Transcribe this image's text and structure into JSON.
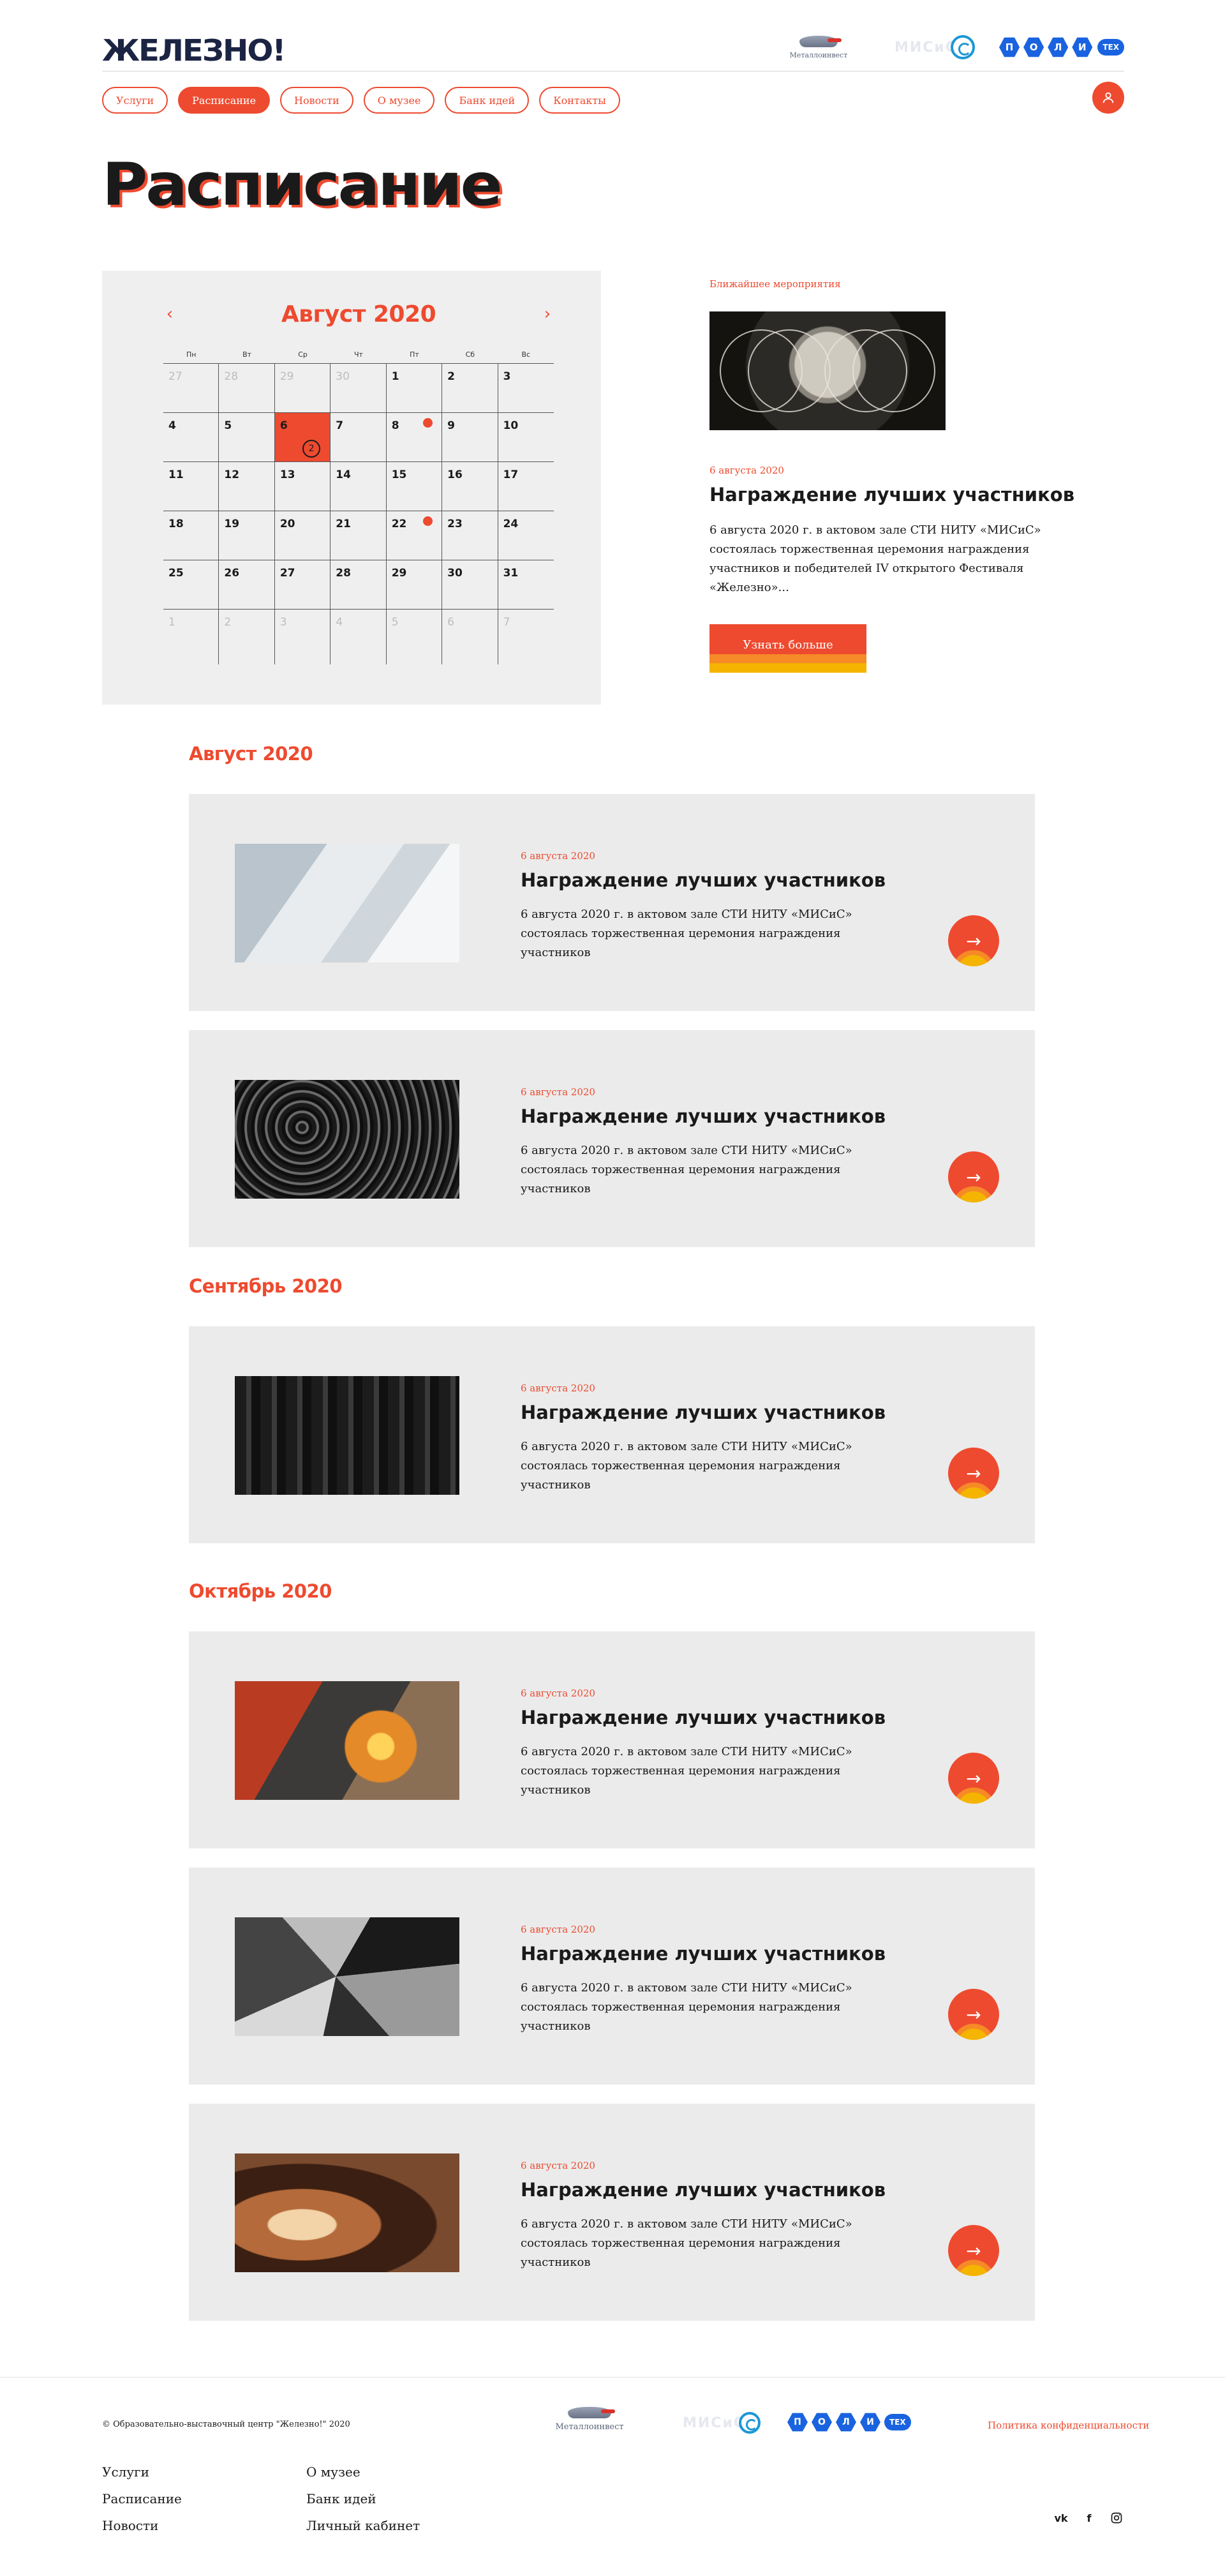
{
  "header": {
    "logo": "ЖЕЛЕЗНО!",
    "partners": {
      "metal": "Металлоинвест",
      "misis": "МИСиС",
      "poly": [
        "П",
        "О",
        "Л",
        "И"
      ],
      "poly_tex": "ТЕХ"
    }
  },
  "nav": {
    "items": [
      {
        "label": "Услуги",
        "active": false
      },
      {
        "label": "Расписание",
        "active": true
      },
      {
        "label": "Новости",
        "active": false
      },
      {
        "label": "О музее",
        "active": false
      },
      {
        "label": "Банк идей",
        "active": false
      },
      {
        "label": "Контакты",
        "active": false
      }
    ]
  },
  "page": {
    "title": "Расписание"
  },
  "calendar": {
    "month": "Август 2020",
    "prev": "‹",
    "next": "›",
    "weekdays": [
      "Пн",
      "Вт",
      "Ср",
      "Чт",
      "Пт",
      "Сб",
      "Вс"
    ],
    "weeks": [
      [
        "27",
        "28",
        "29",
        "30",
        "1",
        "2",
        "3"
      ],
      [
        "4",
        "5",
        "6",
        "7",
        "8",
        "9",
        "10"
      ],
      [
        "11",
        "12",
        "13",
        "14",
        "15",
        "16",
        "17"
      ],
      [
        "18",
        "19",
        "20",
        "21",
        "22",
        "23",
        "24"
      ],
      [
        "25",
        "26",
        "27",
        "28",
        "29",
        "30",
        "31"
      ],
      [
        "1",
        "2",
        "3",
        "4",
        "5",
        "6",
        "7"
      ]
    ],
    "today_badge": "2"
  },
  "nearest": {
    "label": "Ближайшее мероприятия",
    "date": "6 августа 2020",
    "title": "Награждение лучших участников",
    "desc": "6 августа 2020 г. в актовом зале СТИ НИТУ «МИСиС» состоялась торжественная церемония награждения участников и победителей IV открытого Фестиваля «Железно»...",
    "button": "Узнать больше"
  },
  "sections": [
    {
      "month": "Август 2020"
    },
    {
      "month": "Сентябрь 2020"
    },
    {
      "month": "Октябрь 2020"
    }
  ],
  "events": [
    {
      "date": "6 августа 2020",
      "title": "Награждение лучших участников",
      "desc": "6 августа 2020 г. в актовом зале СТИ НИТУ «МИСиС» состоялась торжественная церемония награждения участников"
    },
    {
      "date": "6 августа 2020",
      "title": "Награждение лучших участников",
      "desc": "6 августа 2020 г. в актовом зале СТИ НИТУ «МИСиС» состоялась торжественная церемония награждения участников"
    },
    {
      "date": "6 августа 2020",
      "title": "Награждение лучших участников",
      "desc": "6 августа 2020 г. в актовом зале СТИ НИТУ «МИСиС» состоялась торжественная церемония награждения участников"
    },
    {
      "date": "6 августа 2020",
      "title": "Награждение лучших участников",
      "desc": "6 августа 2020 г. в актовом зале СТИ НИТУ «МИСиС» состоялась торжественная церемония награждения участников"
    },
    {
      "date": "6 августа 2020",
      "title": "Награждение лучших участников",
      "desc": "6 августа 2020 г. в актовом зале СТИ НИТУ «МИСиС» состоялась торжественная церемония награждения участников"
    },
    {
      "date": "6 августа 2020",
      "title": "Награждение лучших участников",
      "desc": "6 августа 2020 г. в актовом зале СТИ НИТУ «МИСиС» состоялась торжественная церемония награждения участников"
    }
  ],
  "footer": {
    "copyright": "© Образовательно-выставочный центр \"Железно!\" 2020",
    "metal": "Металлоинвест",
    "misis": "МИСиС",
    "poly": [
      "П",
      "О",
      "Л",
      "И"
    ],
    "poly_tex": "ТЕХ",
    "privacy": "Политика конфиденциальности",
    "col1": [
      "Услуги",
      "Расписание",
      "Новости"
    ],
    "col2": [
      "О музее",
      "Банк идей",
      "Личный кабинет"
    ],
    "socials": [
      "vk",
      "f"
    ]
  },
  "colors": {
    "accent": "#ee4a2f",
    "brand": "#1c2444",
    "card_bg": "#ebebeb"
  }
}
